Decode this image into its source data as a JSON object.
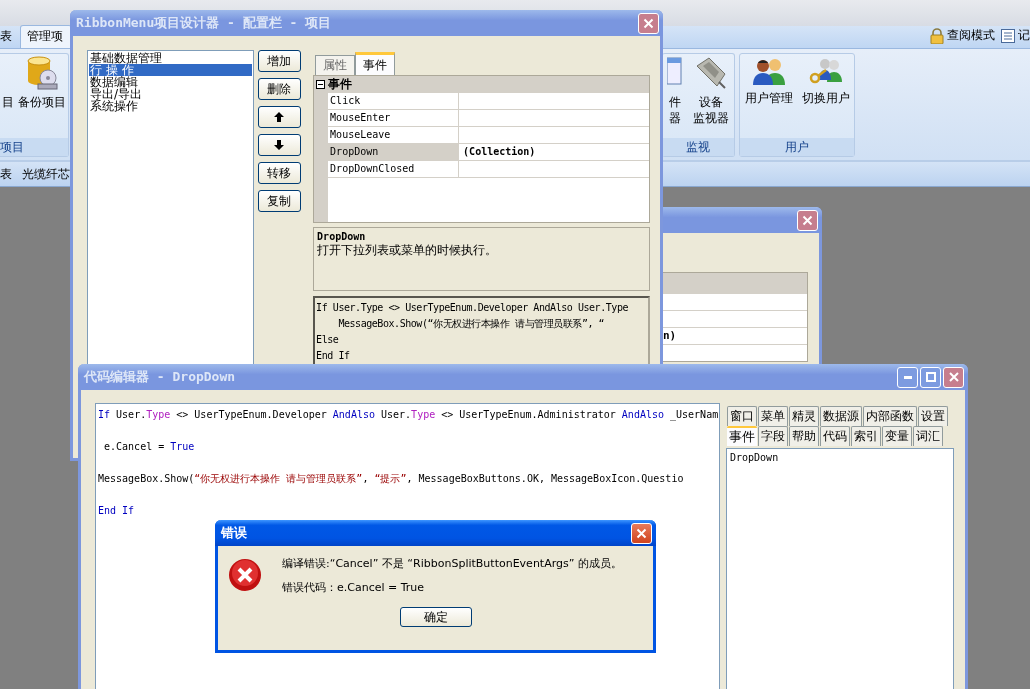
{
  "app": {
    "ribbon_tabs": [
      {
        "label": "表",
        "selected": false
      },
      {
        "label": "管理项",
        "selected": true
      }
    ],
    "header_links": [
      {
        "kind": "lock",
        "label": "查阅模式"
      },
      {
        "kind": "notes",
        "label": "记"
      }
    ],
    "ribbon_groups": [
      {
        "label": "项目",
        "buttons": [
          {
            "kind": "blank",
            "lines": [
              "目"
            ]
          },
          {
            "kind": "backup",
            "lines": [
              "备份项目"
            ]
          }
        ]
      },
      {
        "label": "监视",
        "buttons": [
          {
            "kind": "window",
            "lines": [
              "件",
              "器"
            ]
          },
          {
            "kind": "connector",
            "lines": [
              "设备",
              "监视器"
            ]
          }
        ]
      },
      {
        "label": "用户",
        "buttons": [
          {
            "kind": "users",
            "lines": [
              "用户管理"
            ]
          },
          {
            "kind": "switch",
            "lines": [
              "切换用户"
            ]
          }
        ]
      }
    ],
    "document_tabs": [
      {
        "label": "表"
      },
      {
        "label": "光缆纤芯"
      }
    ]
  },
  "back_window": {
    "cells": [
      "n)"
    ]
  },
  "designer": {
    "title": "RibbonMenu项目设计器 - 配置栏 - 项目",
    "items": [
      {
        "label": "基础数据管理",
        "selected": false
      },
      {
        "label": "行 操 作",
        "selected": true
      },
      {
        "label": "数据编辑",
        "selected": false
      },
      {
        "label": "导出/导出",
        "selected": false
      },
      {
        "label": "系统操作",
        "selected": false
      }
    ],
    "buttons": [
      {
        "kind": "text",
        "label": "增加"
      },
      {
        "kind": "text",
        "label": "删除"
      },
      {
        "kind": "up"
      },
      {
        "kind": "down"
      },
      {
        "kind": "text",
        "label": "转移"
      },
      {
        "kind": "text",
        "label": "复制"
      }
    ],
    "tabs": [
      {
        "label": "属性",
        "selected": false
      },
      {
        "label": "事件",
        "selected": true
      }
    ],
    "property_grid": {
      "category": "事件",
      "expanded": true,
      "rows": [
        {
          "name": "Click",
          "selected": false
        },
        {
          "name": "MouseEnter",
          "selected": false
        },
        {
          "name": "MouseLeave",
          "selected": false
        },
        {
          "name": "DropDown",
          "value": "(Collection)",
          "selected": true
        },
        {
          "name": "DropDownClosed",
          "selected": false
        }
      ]
    },
    "description": {
      "title": "DropDown",
      "text": "打开下拉列表或菜单的时候执行。"
    },
    "code_preview": [
      "If User.Type <> UserTypeEnum.Developer AndAlso User.Type",
      "    MessageBox.Show(“你无权进行本操作 请与管理员联系”, “",
      "Else",
      "End If"
    ]
  },
  "editor": {
    "title": "代码编辑器 - DropDown",
    "code": [
      [
        {
          "kind": "keyword",
          "text": "If"
        },
        {
          "kind": "plain",
          "text": " User."
        },
        {
          "kind": "property",
          "text": "Type"
        },
        {
          "kind": "plain",
          "text": " <> UserTypeEnum.Developer "
        },
        {
          "kind": "keyword",
          "text": "AndAlso"
        },
        {
          "kind": "plain",
          "text": " User."
        },
        {
          "kind": "property",
          "text": "Type"
        },
        {
          "kind": "plain",
          "text": " <> UserTypeEnum.Administrator "
        },
        {
          "kind": "keyword",
          "text": "AndAlso"
        },
        {
          "kind": "plain",
          "text": " _UserNam"
        }
      ],
      [
        {
          "kind": "plain",
          "text": " e.Cancel = "
        },
        {
          "kind": "keyword",
          "text": "True"
        }
      ],
      [
        {
          "kind": "plain",
          "text": "MessageBox.Show("
        },
        {
          "kind": "string",
          "text": "“你无权进行本操作 请与管理员联系”"
        },
        {
          "kind": "plain",
          "text": ", "
        },
        {
          "kind": "string",
          "text": "“提示”"
        },
        {
          "kind": "plain",
          "text": ", MessageBoxButtons.OK, MessageBoxIcon.Questio"
        }
      ],
      [
        {
          "kind": "keyword",
          "text": "End If"
        }
      ]
    ],
    "tab_rows": [
      {
        "tabs": [
          {
            "label": "窗口",
            "selected": false
          },
          {
            "label": "菜单",
            "selected": false
          },
          {
            "label": "精灵",
            "selected": false
          },
          {
            "label": "数据源",
            "selected": false
          },
          {
            "label": "内部函数",
            "selected": false
          },
          {
            "label": "设置",
            "selected": false
          }
        ]
      },
      {
        "tabs": [
          {
            "label": "事件",
            "selected": true
          },
          {
            "label": "字段",
            "selected": false
          },
          {
            "label": "帮助",
            "selected": false
          },
          {
            "label": "代码",
            "selected": false
          },
          {
            "label": "索引",
            "selected": false
          },
          {
            "label": "变量",
            "selected": false
          },
          {
            "label": "词汇",
            "selected": false
          }
        ]
      }
    ],
    "list": [
      {
        "label": "DropDown"
      }
    ]
  },
  "dialog": {
    "title": "错误",
    "message": "编译错误:“Cancel” 不是 “RibbonSplitButtonEventArgs” 的成员。",
    "detail": "错误代码：e.Cancel = True",
    "button": "确定"
  }
}
